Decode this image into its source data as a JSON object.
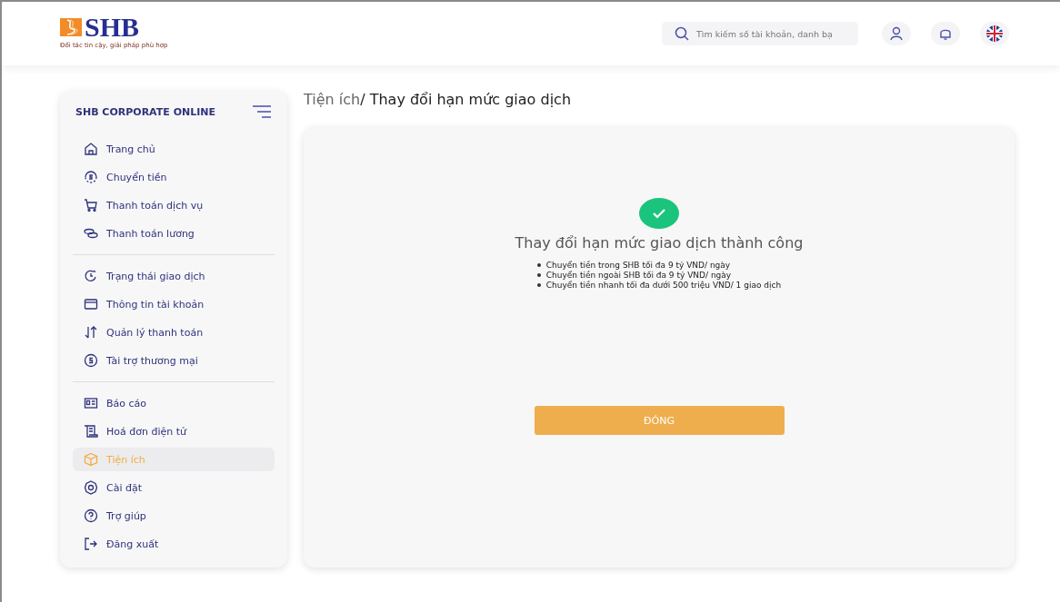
{
  "header": {
    "logo": {
      "name": "SHB",
      "tagline": "Đối tác tin cậy, giải pháp phù hợp"
    },
    "search": {
      "placeholder": "Tìm kiếm số tài khoản, danh bạ"
    }
  },
  "sidebar": {
    "title": "SHB CORPORATE ONLINE",
    "groups": [
      {
        "items": [
          {
            "label": "Trang chủ",
            "selected": false
          },
          {
            "label": "Chuyển tiền",
            "selected": false
          },
          {
            "label": "Thanh toán dịch vụ",
            "selected": false
          },
          {
            "label": "Thanh toán lương",
            "selected": false
          }
        ]
      },
      {
        "items": [
          {
            "label": "Trạng thái giao dịch",
            "selected": false
          },
          {
            "label": "Thông tin tài khoản",
            "selected": false
          },
          {
            "label": "Quản lý thanh toán",
            "selected": false
          },
          {
            "label": "Tài trợ thương mại",
            "selected": false
          }
        ]
      },
      {
        "items": [
          {
            "label": "Báo cáo",
            "selected": false
          },
          {
            "label": "Hoá đơn điện tử",
            "selected": false
          },
          {
            "label": "Tiện ích",
            "selected": true
          },
          {
            "label": "Cài đặt",
            "selected": false
          },
          {
            "label": "Trợ giúp",
            "selected": false
          },
          {
            "label": "Đăng xuất",
            "selected": false
          }
        ]
      }
    ]
  },
  "breadcrumb": {
    "parent": "Tiện ích",
    "current": "/ Thay đổi hạn mức giao dịch"
  },
  "result": {
    "title": "Thay đổi hạn mức giao dịch thành công",
    "details": [
      "Chuyển tiền trong SHB tối đa 9 tỷ VND/ ngày",
      "Chuyển tiền ngoài SHB tối đa 9 tỷ VND/ ngày",
      "Chuyển tiền nhanh tối đa dưới 500 triệu VND/ 1 giao dịch"
    ],
    "button": "ĐÓNG"
  }
}
